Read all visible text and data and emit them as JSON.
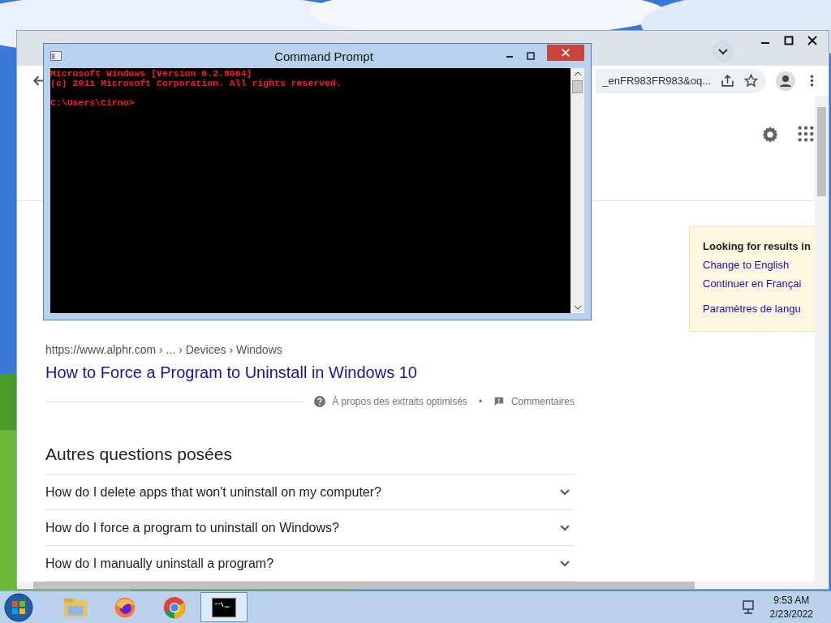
{
  "browser": {
    "address_fragment": "_enFR983FR983&oq...",
    "result": {
      "url": "https://www.alphr.com › ... › Devices › Windows",
      "title": "How to Force a Program to Uninstall in Windows 10",
      "about": "À propos des extraits optimisés",
      "separator": "•",
      "feedback": "Commentaires"
    },
    "questions_heading": "Autres questions posées",
    "questions": [
      {
        "text": "How do I delete apps that won't uninstall on my computer?",
        "expanded": false
      },
      {
        "text": "How do I force a program to uninstall on Windows?",
        "expanded": false
      },
      {
        "text": "How do I manually uninstall a program?",
        "expanded": false
      }
    ],
    "language_panel": {
      "heading": "Looking for results in",
      "links": [
        "Change to English",
        "Continuer en Françai",
        "Paramètres de langu"
      ]
    }
  },
  "cmd": {
    "title": "Command Prompt",
    "lines": [
      {
        "text": "Microsoft Windows [Version 6.2.8064]",
        "kind": "output"
      },
      {
        "text": "(c) 2011 Microsoft Corporation. All rights reserved.",
        "kind": "output"
      },
      {
        "text": "C:\\Users\\Cirno>",
        "kind": "prompt"
      }
    ]
  },
  "taskbar": {
    "apps": [
      {
        "kind": "explorer",
        "selected": false
      },
      {
        "kind": "firefox",
        "selected": false
      },
      {
        "kind": "chrome",
        "selected": false
      },
      {
        "kind": "terminal",
        "selected": true
      }
    ],
    "clock": {
      "time": "9:53 AM",
      "date": "2/23/2022"
    }
  }
}
